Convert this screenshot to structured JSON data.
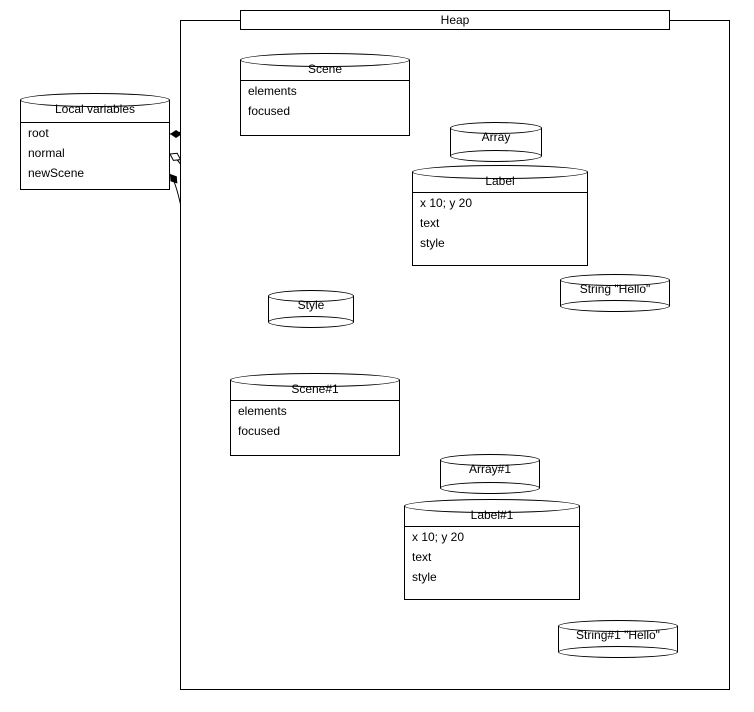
{
  "heap": {
    "title": "Heap"
  },
  "locals": {
    "title": "Local variables",
    "fields": [
      "root",
      "normal",
      "newScene"
    ]
  },
  "scene": {
    "title": "Scene",
    "fields": [
      "elements",
      "focused"
    ]
  },
  "array": {
    "title": "Array"
  },
  "label": {
    "title": "Label",
    "fields": [
      "x 10; y 20",
      "text",
      "style"
    ]
  },
  "string": {
    "title": "String \"Hello\""
  },
  "style": {
    "title": "Style"
  },
  "scene1": {
    "title": "Scene#1",
    "fields": [
      "elements",
      "focused"
    ]
  },
  "array1": {
    "title": "Array#1"
  },
  "label1": {
    "title": "Label#1",
    "fields": [
      "x 10; y 20",
      "text",
      "style"
    ]
  },
  "string1": {
    "title": "String#1 \"Hello\""
  }
}
